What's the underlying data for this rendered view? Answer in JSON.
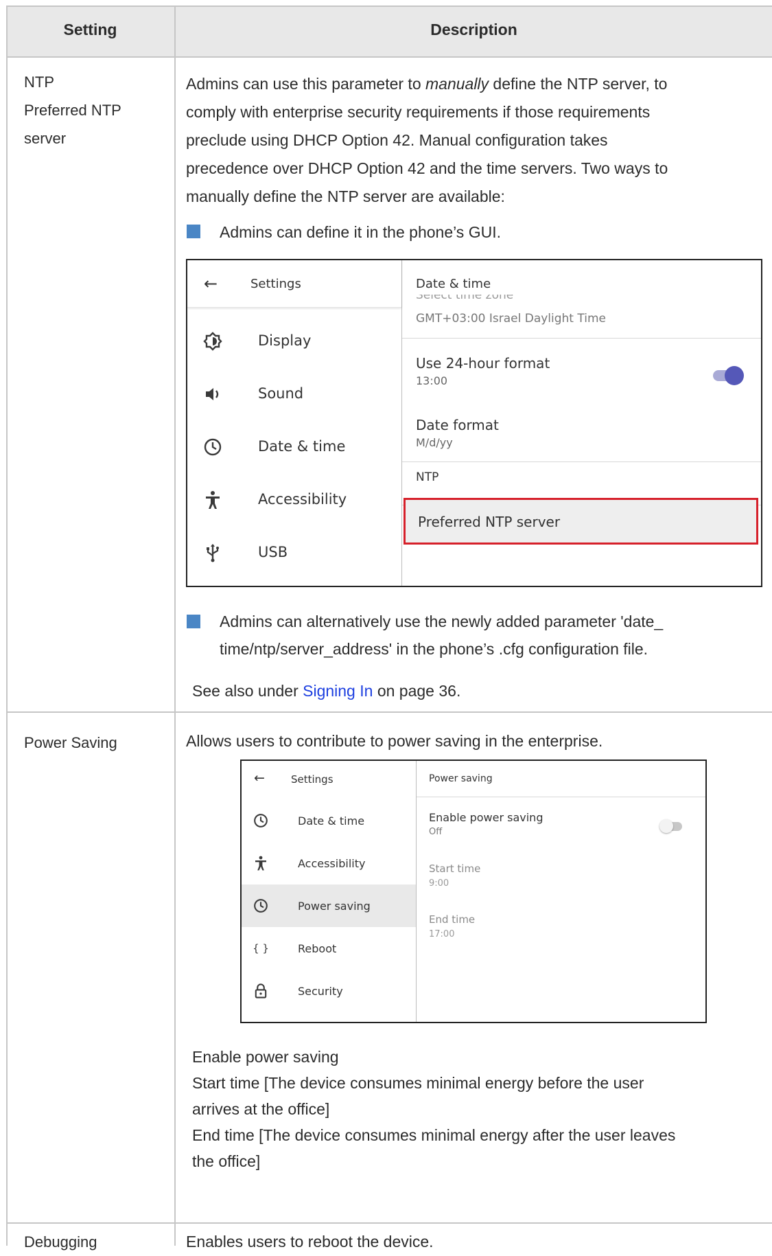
{
  "table": {
    "header": {
      "setting": "Setting",
      "description": "Description"
    },
    "rows": {
      "ntp": {
        "setting_lines": [
          "NTP",
          "Preferred NTP",
          "server"
        ],
        "desc_lines": [
          "Admins can use this parameter to ",
          "manually",
          " define the NTP server, to",
          "comply with enterprise security requirements if those requirements",
          "preclude using DHCP Option 42. Manual configuration takes",
          "precedence over DHCP Option 42 and the time servers. Two ways to",
          "manually define the NTP server are available:"
        ],
        "bullet1": "Admins can define it in the phone’s GUI.",
        "bullet2_lines": [
          "Admins can alternatively use the newly added parameter 'date_",
          "time/ntp/server_address' in the phone’s .cfg configuration file."
        ],
        "see_also": {
          "prefix": "See also under ",
          "link": "Signing In",
          "suffix": "  on page 36."
        },
        "screenshot": {
          "back_icon": "arrow-left-icon",
          "left_title": "Settings",
          "items": [
            {
              "icon": "display-icon",
              "label": "Display"
            },
            {
              "icon": "sound-icon",
              "label": "Sound"
            },
            {
              "icon": "clock-icon",
              "label": "Date & time"
            },
            {
              "icon": "accessibility-icon",
              "label": "Accessibility"
            },
            {
              "icon": "usb-icon",
              "label": "USB"
            }
          ],
          "right_title": "Date & time",
          "partial_label": "Select time zone",
          "timezone": "GMT+03:00 Israel Daylight Time",
          "use24_title": "Use 24-hour format",
          "use24_value": "13:00",
          "use24_on": true,
          "dateformat_title": "Date format",
          "dateformat_value": "M/d/yy",
          "ntp_label": "NTP",
          "preferred_label": "Preferred NTP server",
          "highlight_color": "#d6202a",
          "toggle_color": "#5558b8"
        }
      },
      "power": {
        "setting": "Power Saving",
        "desc": "Allows users to contribute to power saving in the enterprise.",
        "screenshot": {
          "back_icon": "arrow-left-icon",
          "left_title": "Settings",
          "items": [
            {
              "icon": "clock-icon",
              "label": "Date & time",
              "selected": false
            },
            {
              "icon": "accessibility-icon",
              "label": "Accessibility",
              "selected": false
            },
            {
              "icon": "clock-icon",
              "label": "Power saving",
              "selected": true
            },
            {
              "icon": "braces-icon",
              "label": "Reboot",
              "selected": false
            },
            {
              "icon": "lock-icon",
              "label": "Security",
              "selected": false
            }
          ],
          "right_title": "Power saving",
          "enable_title": "Enable power saving",
          "enable_value": "Off",
          "enable_on": false,
          "start_title": "Start time",
          "start_value": "9:00",
          "end_title": "End time",
          "end_value": "17:00"
        },
        "after_lines": [
          "Enable power saving",
          "Start time [The device consumes minimal energy before the user",
          "arrives at the office]",
          "End time [The device consumes minimal energy after the user leaves",
          "the office]"
        ]
      },
      "debug": {
        "setting": "Debugging",
        "desc": "Enables users to reboot the device."
      }
    },
    "colors": {
      "header_bg": "#e8e8e8",
      "border": "#c6c6c6",
      "bullet": "#4a86c5",
      "link": "#1d3fe0"
    }
  }
}
